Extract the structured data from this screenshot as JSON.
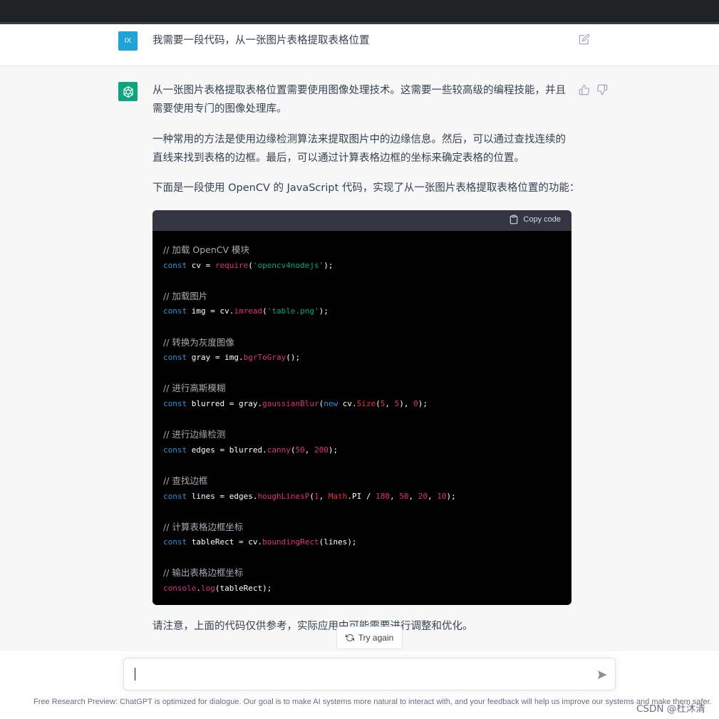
{
  "user_message": {
    "avatar_text": "IX",
    "text": "我需要一段代码，从一张图片表格提取表格位置"
  },
  "assistant": {
    "paragraphs": [
      "从一张图片表格提取表格位置需要使用图像处理技术。这需要一些较高级的编程技能，并且需要使用专门的图像处理库。",
      "一种常用的方法是使用边缘检测算法来提取图片中的边缘信息。然后，可以通过查找连续的直线来找到表格的边框。最后，可以通过计算表格边框的坐标来确定表格的位置。",
      "下面是一段使用 OpenCV 的 JavaScript 代码，实现了从一张图片表格提取表格位置的功能："
    ],
    "copy_code_label": "Copy code",
    "code": {
      "c1": "// 加载 OpenCV 模块",
      "c2": "// 加载图片",
      "c3": "// 转换为灰度图像",
      "c4": "// 进行高斯模糊",
      "c5": "// 进行边缘检测",
      "c6": "// 查找边框",
      "c7": "// 计算表格边框坐标",
      "c8": "// 输出表格边框坐标"
    },
    "closing": "请注意，上面的代码仅供参考，实际应用中可能需要进行调整和优化。"
  },
  "try_again_label": "Try again",
  "input": {
    "value": ""
  },
  "footer": "Free Research Preview: ChatGPT is optimized for dialogue. Our goal is to make AI systems more natural to interact with, and your feedback will help us improve our systems and make them safer.",
  "watermark": "CSDN @杜沐清",
  "colors": {
    "gpt_green": "#10a37f",
    "user_avatar": "#1ea2d8",
    "code_bg": "#000000"
  }
}
